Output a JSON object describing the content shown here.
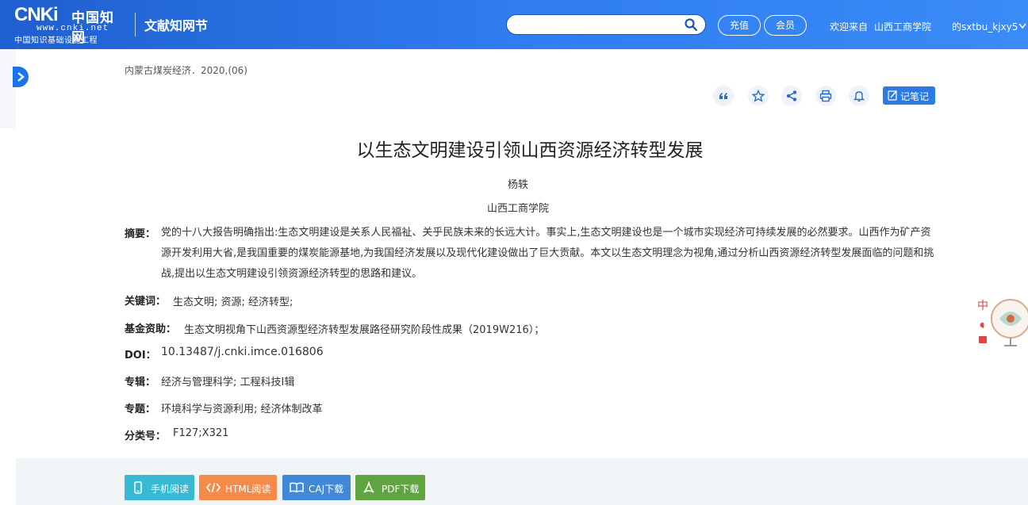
{
  "header": {
    "logo": {
      "brand": "CNKi",
      "brand_cn": "中国知网",
      "url": "www.cnki.net",
      "subtitle": "中国知识基础设施工程"
    },
    "section_title": "文献知网节",
    "search": {
      "value": "",
      "placeholder": ""
    },
    "recharge_label": "充值",
    "member_label": "会员",
    "welcome_text": "欢迎来自",
    "organization": "山西工商学院",
    "user": "的sxtbu_kjxy5",
    "accent_color": "#2f7df0"
  },
  "article": {
    "source": "内蒙古煤炭经济．2020,(06)",
    "toolbar": {
      "icons": [
        "quote-icon",
        "star-icon",
        "share-icon",
        "print-icon",
        "bell-icon"
      ],
      "note_label": "记笔记"
    },
    "title": "以生态文明建设引领山西资源经济转型发展",
    "author": "杨轶",
    "affiliation": "山西工商学院",
    "abstract": {
      "label": "摘要：",
      "text": "党的十八大报告明确指出:生态文明建设是关系人民福祉、关乎民族未来的长远大计。事实上,生态文明建设也是一个城市实现经济可持续发展的必然要求。山西作为矿产资源开发利用大省,是我国重要的煤炭能源基地,为我国经济发展以及现代化建设做出了巨大贡献。本文以生态文明理念为视角,通过分析山西资源经济转型发展面临的问题和挑战,提出以生态文明建设引领资源经济转型的思路和建议。"
    },
    "keywords": {
      "label": "关键词：",
      "value": "生态文明;  资源;  经济转型;"
    },
    "fund": {
      "label": "基金资助：",
      "value": "生态文明视角下山西资源型经济转型发展路径研究阶段性成果（2019W216）；"
    },
    "doi": {
      "label": "DOI：",
      "value": "10.13487/j.cnki.imce.016806"
    },
    "album": {
      "label": "专辑：",
      "value": "经济与管理科学; 工程科技Ⅰ辑"
    },
    "topic": {
      "label": "专题：",
      "value": "环境科学与资源利用; 经济体制改革"
    },
    "classification": {
      "label": "分类号：",
      "value": "F127;X321"
    }
  },
  "downloads": {
    "mobile": "手机阅读",
    "html": "HTML阅读",
    "caj": "CAJ下载",
    "pdf": "PDF下载"
  },
  "side_widget": {
    "char": "中"
  }
}
